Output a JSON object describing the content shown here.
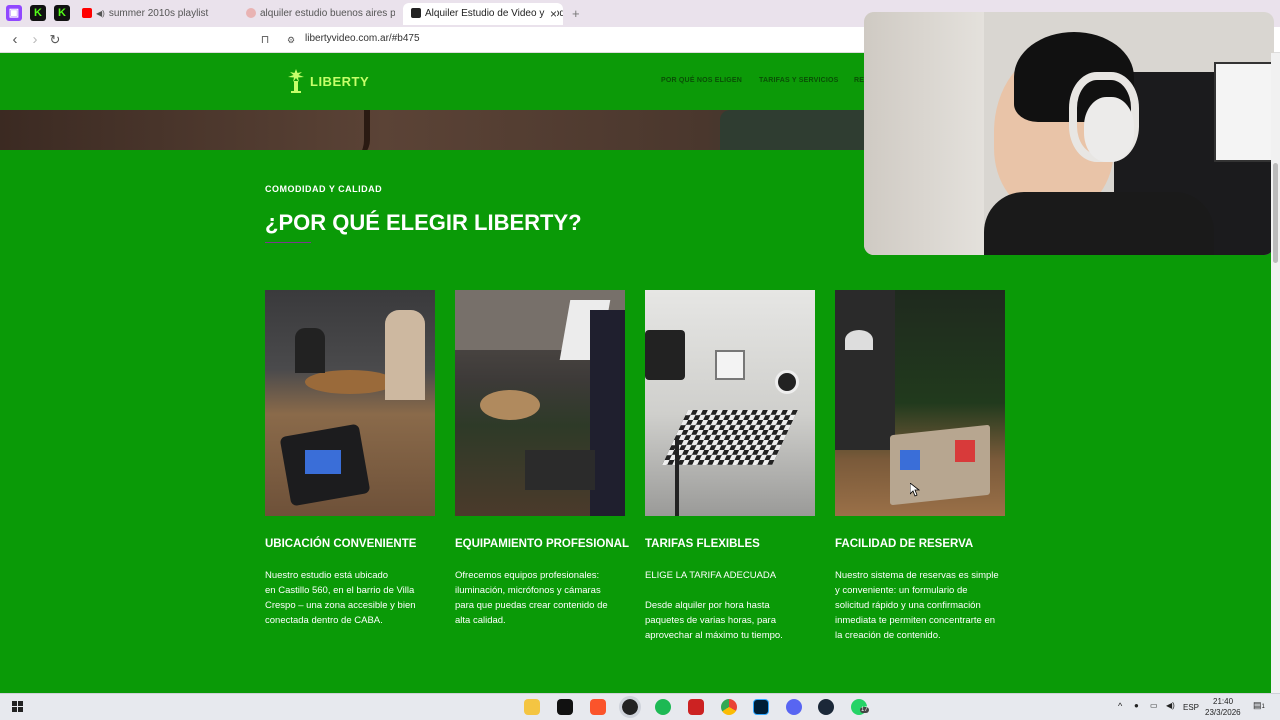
{
  "browser": {
    "tabs": [
      {
        "label": "summer 2010s playlist"
      },
      {
        "label": "alquiler estudio buenos aires por hor"
      },
      {
        "label": "Alquiler Estudio de Video y Pod"
      }
    ],
    "new_tab_label": "+",
    "close_tab_label": "×",
    "url": "libertyvideo.com.ar/#b475"
  },
  "site": {
    "logo_text": "LIBERTY",
    "nav": [
      {
        "label": "POR QUÉ NOS ELIGEN"
      },
      {
        "label": "TARIFAS Y SERVICIOS"
      },
      {
        "label": "RE"
      }
    ]
  },
  "section": {
    "eyebrow": "COMODIDAD Y CALIDAD",
    "heading": "¿POR QUÉ ELEGIR LIBERTY?"
  },
  "features": [
    {
      "title": "UBICACIÓN CONVENIENTE",
      "lines": [
        "Nuestro estudio está ubicado",
        "en Castillo 560, en el barrio de Villa",
        "Crespo – una zona accesible y bien",
        "conectada dentro de CABA."
      ]
    },
    {
      "title": "EQUIPAMIENTO PROFESIONAL",
      "lines": [
        "Ofrecemos equipos profesionales:",
        "iluminación, micrófonos y cámaras",
        "para que puedas crear contenido de",
        "alta calidad."
      ]
    },
    {
      "title": "TARIFAS FLEXIBLES",
      "lines": [
        "ELIGE LA TARIFA ADECUADA",
        "",
        "Desde alquiler por hora hasta",
        "paquetes de varias horas, para",
        "aprovechar al máximo tu tiempo."
      ]
    },
    {
      "title": "FACILIDAD DE RESERVA",
      "lines": [
        "Nuestro sistema de reservas es simple",
        "y conveniente: un formulario de",
        "solicitud rápido y una confirmación",
        "inmediata te permiten concentrarte en",
        "la creación de contenido."
      ]
    }
  ],
  "taskbar": {
    "language": "ESP",
    "time": "21:40",
    "date": "23/3/2026",
    "badge": "17",
    "notif_count": "1"
  },
  "colors": {
    "brand_green": "#0a9a07",
    "logo_green": "#c6ff6a"
  }
}
